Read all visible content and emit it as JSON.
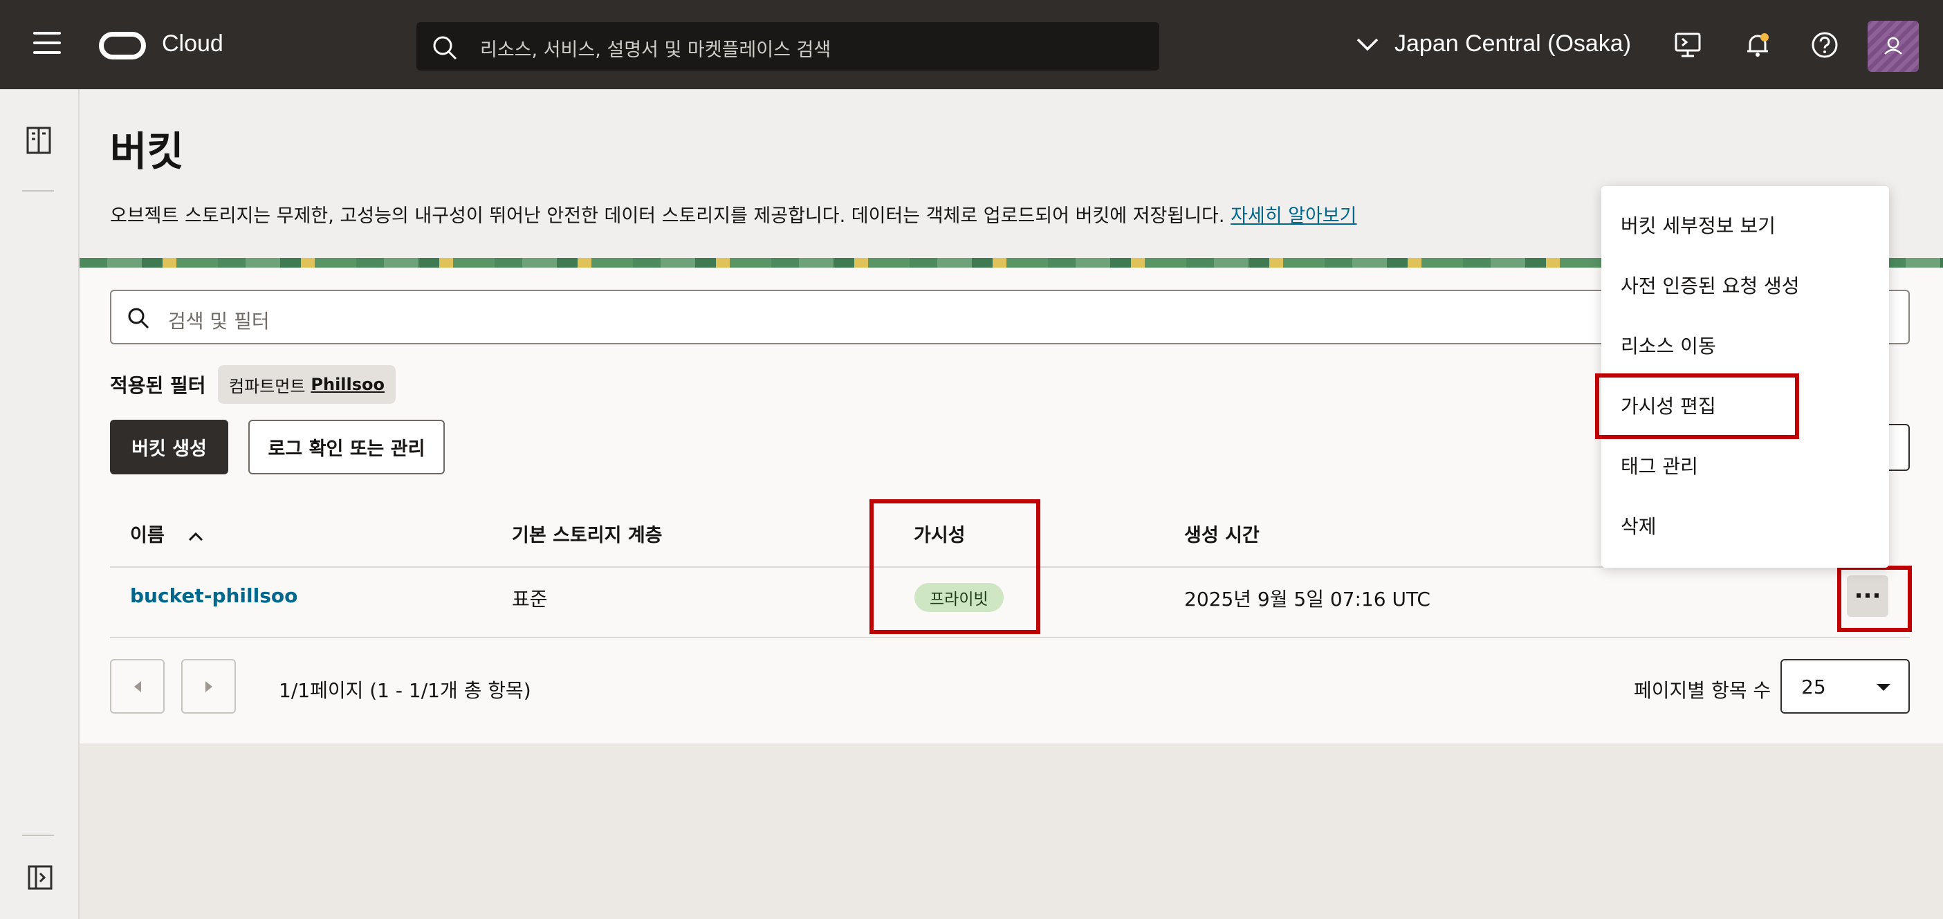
{
  "topbar": {
    "brand": "Cloud",
    "search_placeholder": "리소스, 서비스, 설명서 및 마켓플레이스 검색",
    "region": "Japan Central (Osaka)",
    "icons": [
      "menu-icon",
      "oracle-logo-icon",
      "search-icon",
      "chevron-down-icon",
      "cloud-shell-icon",
      "bell-icon",
      "help-icon",
      "profile-icon"
    ]
  },
  "page": {
    "title": "버킷",
    "description": "오브젝트 스토리지는 무제한, 고성능의 내구성이 뛰어난 안전한 데이터 스토리지를 제공합니다. 데이터는 객체로 업로드되어 버킷에 저장됩니다.",
    "learn_more": "자세히 알아보기"
  },
  "filter": {
    "search_placeholder": "검색 및 필터",
    "applied_label": "적용된 필터",
    "chip_prefix": "컴파트먼트",
    "chip_value": "Phillsoo"
  },
  "actions": {
    "create": "버킷 생성",
    "logs": "로그 확인 또는 관리"
  },
  "table": {
    "headers": {
      "name": "이름",
      "tier": "기본 스토리지 계층",
      "visibility": "가시성",
      "created": "생성 시간"
    },
    "rows": [
      {
        "name": "bucket-phillsoo",
        "tier": "표준",
        "visibility": "프라이빗",
        "created": "2025년 9월 5일 07:16 UTC"
      }
    ]
  },
  "pagination": {
    "summary": "1/1페이지 (1 - 1/1개 총 항목)",
    "per_page_label": "페이지별 항목 수",
    "per_page_value": "25"
  },
  "menu": {
    "items": [
      "버킷 세부정보 보기",
      "사전 인증된 요청 생성",
      "리소스 이동",
      "가시성 편집",
      "태그 관리",
      "삭제"
    ]
  },
  "colors": {
    "topbar": "#312d2a",
    "link": "#00688c",
    "highlight": "#c00000",
    "badge": "#cfe6c3"
  }
}
